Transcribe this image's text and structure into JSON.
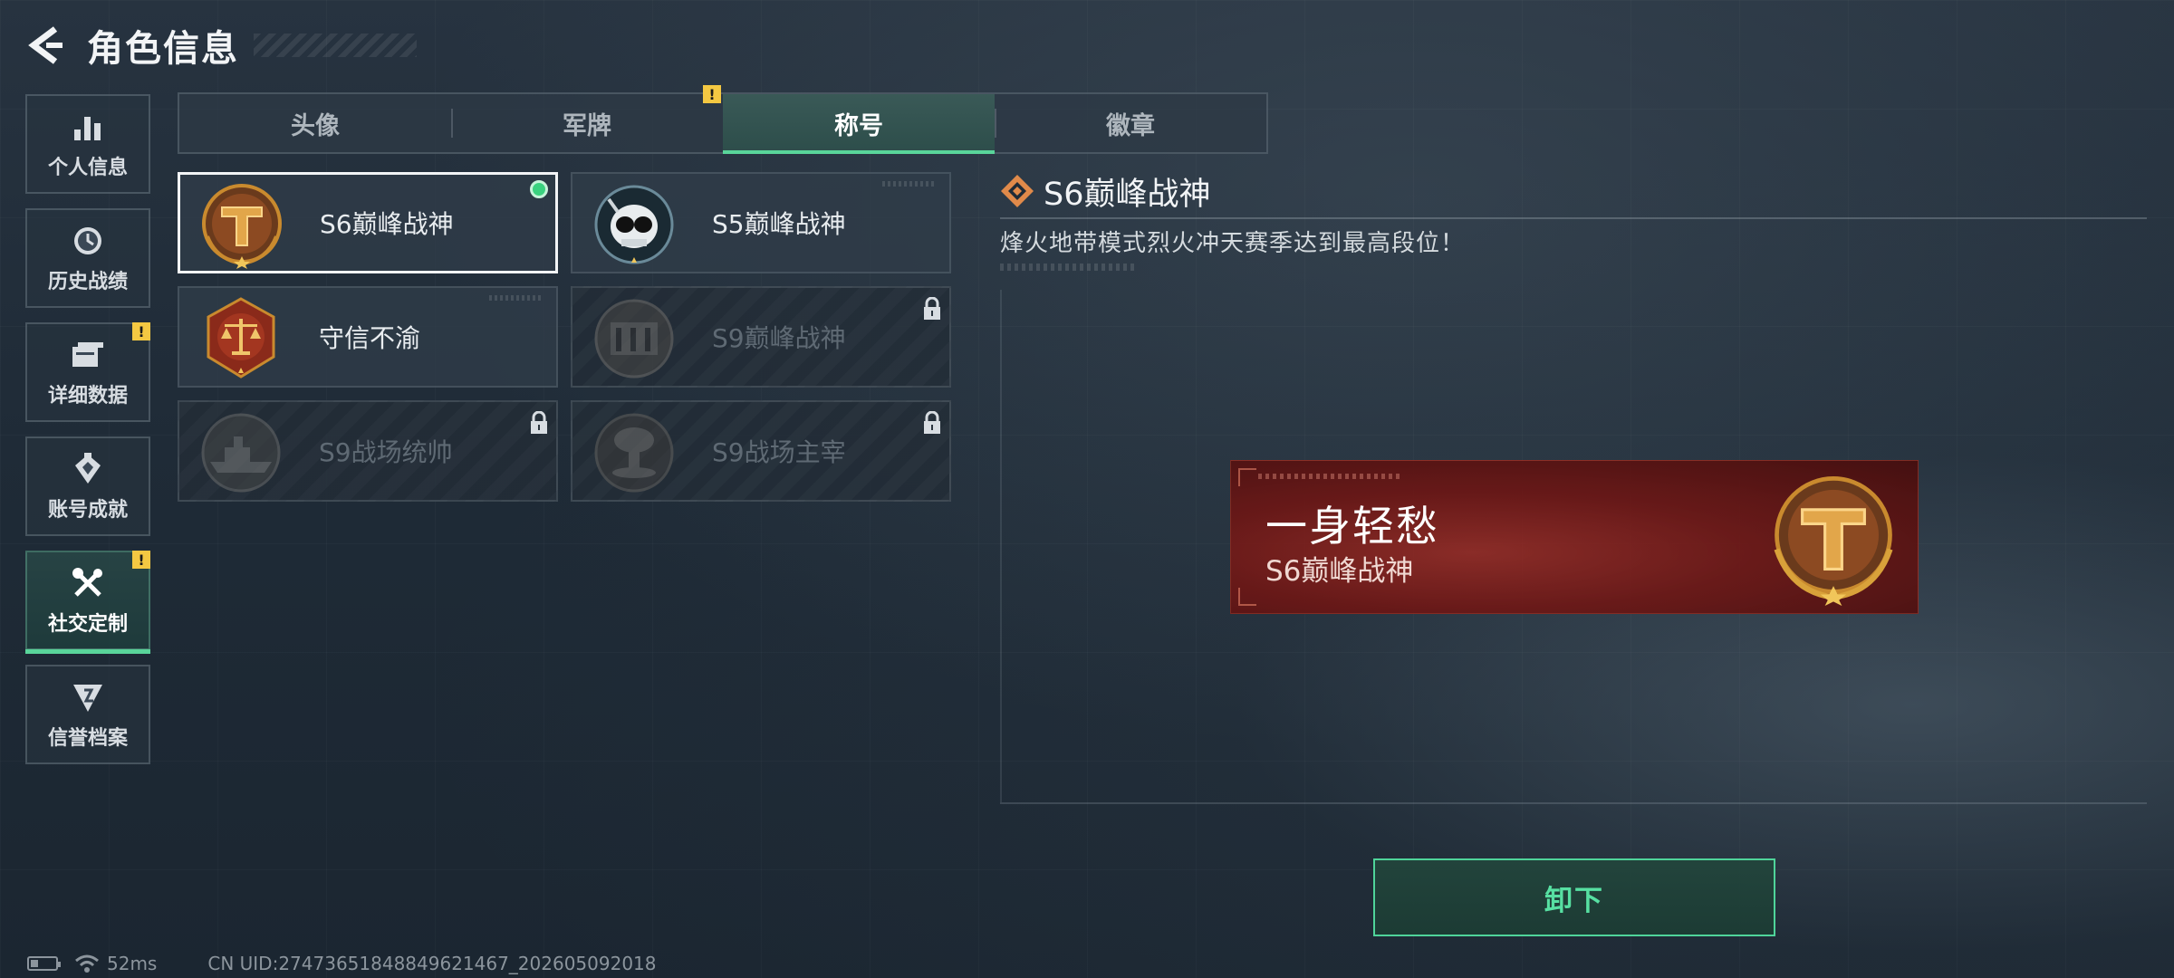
{
  "header": {
    "title": "角色信息"
  },
  "sidebar": {
    "items": [
      {
        "label": "个人信息",
        "icon": "bar-chart-icon",
        "badge": false,
        "active": false
      },
      {
        "label": "历史战绩",
        "icon": "clock-icon",
        "badge": false,
        "active": false
      },
      {
        "label": "详细数据",
        "icon": "folder-icon",
        "badge": true,
        "active": false
      },
      {
        "label": "账号成就",
        "icon": "medal-icon",
        "badge": false,
        "active": false
      },
      {
        "label": "社交定制",
        "icon": "tools-icon",
        "badge": true,
        "active": true
      },
      {
        "label": "信誉档案",
        "icon": "shield-icon",
        "badge": false,
        "active": false
      }
    ],
    "badge_text": "!"
  },
  "tabs": [
    {
      "label": "头像",
      "active": false,
      "badge": false
    },
    {
      "label": "军牌",
      "active": false,
      "badge": true
    },
    {
      "label": "称号",
      "active": true,
      "badge": false
    },
    {
      "label": "徽章",
      "active": false,
      "badge": false
    }
  ],
  "cards": [
    {
      "name": "S6巅峰战神",
      "locked": false,
      "equipped": true,
      "selected": true,
      "emblem": "gold-t-emblem"
    },
    {
      "name": "S5巅峰战神",
      "locked": false,
      "equipped": false,
      "selected": false,
      "emblem": "skull-emblem"
    },
    {
      "name": "守信不渝",
      "locked": false,
      "equipped": false,
      "selected": false,
      "emblem": "scales-emblem"
    },
    {
      "name": "S9巅峰战神",
      "locked": true,
      "equipped": false,
      "selected": false,
      "emblem": "dam-emblem"
    },
    {
      "name": "S9战场统帅",
      "locked": true,
      "equipped": false,
      "selected": false,
      "emblem": "warship-emblem"
    },
    {
      "name": "S9战场主宰",
      "locked": true,
      "equipped": false,
      "selected": false,
      "emblem": "mushroom-cloud-emblem"
    }
  ],
  "detail": {
    "title": "S6巅峰战神",
    "description": "烽火地带模式烈火冲天赛季达到最高段位！"
  },
  "preview": {
    "player_name": "一身轻愁",
    "title": "S6巅峰战神"
  },
  "action": {
    "unequip_label": "卸下"
  },
  "status": {
    "ping": "52ms",
    "uid": "CN UID:2747365184884962146​7_202605092018"
  },
  "colors": {
    "accent_green": "#59d59a",
    "badge_yellow": "#f4c842",
    "banner_red": "#8a1e1a",
    "emblem_gold": "#c98a2e"
  }
}
